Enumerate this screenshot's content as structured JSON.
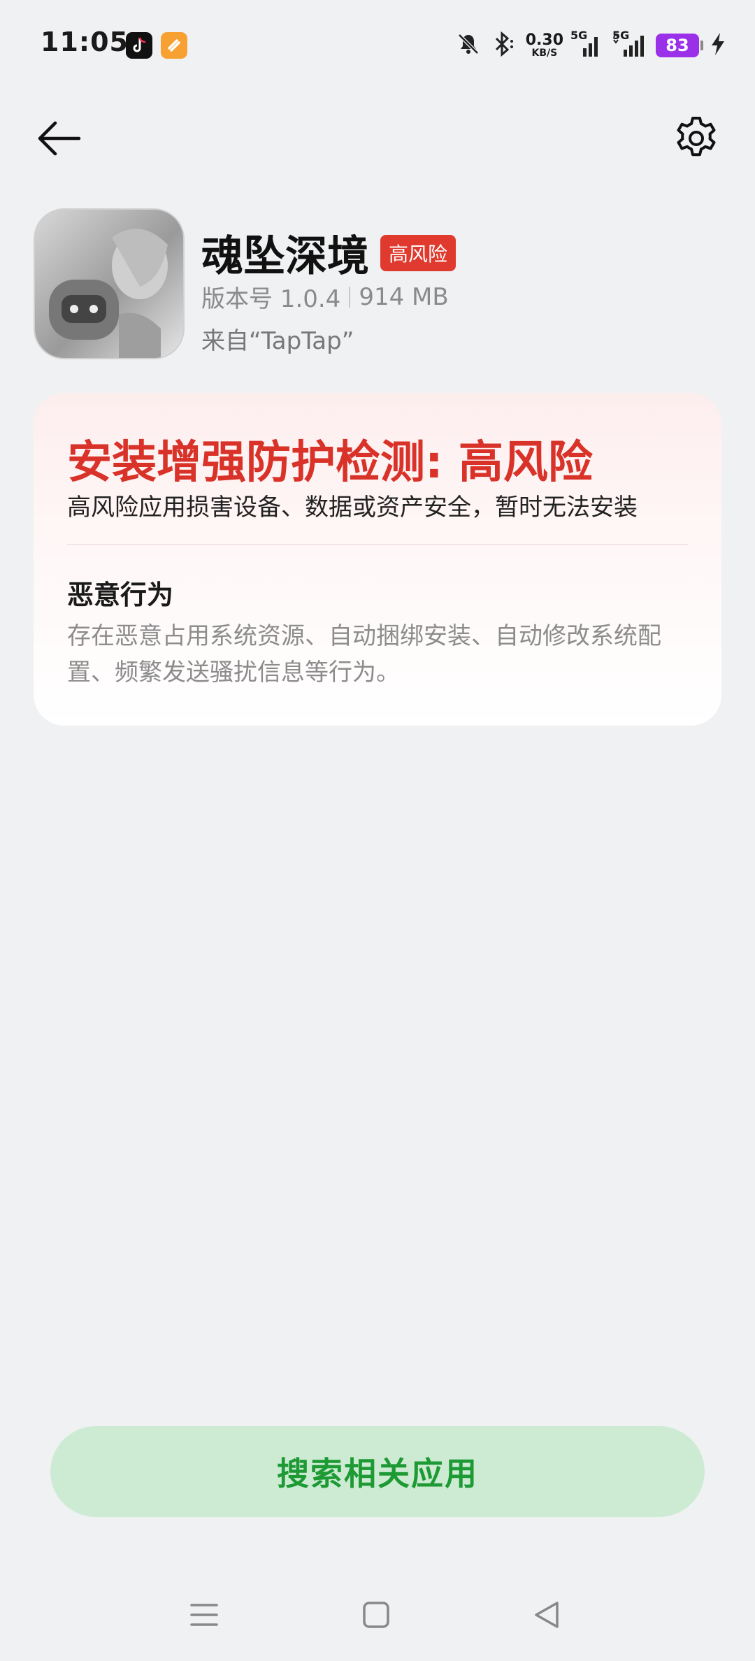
{
  "status_bar": {
    "time": "11:05",
    "net_speed_value": "0.30",
    "net_speed_unit": "KB/S",
    "network_1": "5G",
    "network_2": "5G",
    "battery": "83"
  },
  "app": {
    "name": "魂坠深境",
    "risk_badge": "高风险",
    "version": "版本号 1.0.4",
    "size": "914 MB",
    "source": "来自“TapTap”"
  },
  "warning": {
    "title": "安装增强防护检测: 高风险",
    "subtitle": "高风险应用损害设备、数据或资产安全，暂时无法安装",
    "section_title": "恶意行为",
    "section_desc": "存在恶意占用系统资源、自动捆绑安装、自动修改系统配置、频繁发送骚扰信息等行为。"
  },
  "actions": {
    "search_related": "搜索相关应用"
  },
  "colors": {
    "background": "#f0f1f3",
    "danger": "#d83229",
    "badge": "#e03a2f",
    "button_bg": "#cdebd3",
    "button_text": "#1e9a34",
    "battery": "#9b30e9"
  },
  "icons": [
    "bell-off-icon",
    "bluetooth-icon",
    "signal-icon",
    "battery-icon",
    "charging-icon",
    "back-arrow-icon",
    "gear-icon",
    "menu-icon",
    "home-icon",
    "back-triangle-icon"
  ]
}
